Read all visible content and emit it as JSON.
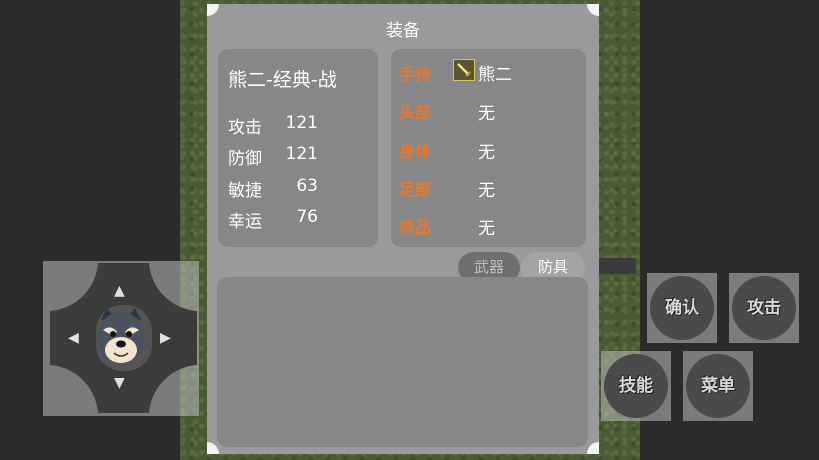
{
  "window": {
    "title": "装备"
  },
  "character": {
    "name": "熊二-经典-战",
    "stats": [
      {
        "label": "攻击",
        "value": "121"
      },
      {
        "label": "防御",
        "value": "121"
      },
      {
        "label": "敏捷",
        "value": "63"
      },
      {
        "label": "幸运",
        "value": "76"
      }
    ]
  },
  "equipment": {
    "slots": [
      {
        "label": "手持",
        "value": "熊二",
        "icon": "sword-icon"
      },
      {
        "label": "头部",
        "value": "无"
      },
      {
        "label": "身体",
        "value": "无"
      },
      {
        "label": "足部",
        "value": "无"
      },
      {
        "label": "饰品",
        "value": "无"
      }
    ]
  },
  "tabs": {
    "weapon": "武器",
    "armor": "防具",
    "active": "armor"
  },
  "controls": {
    "confirm": "确认",
    "attack": "攻击",
    "skill": "技能",
    "menu": "菜单"
  },
  "colors": {
    "slot_label": "#e8772e",
    "panel_bg": "#9a9a9c",
    "box_bg": "#878789"
  },
  "icons": {
    "dpad_center": "bear-face-icon",
    "arrows": [
      "arrow-up-icon",
      "arrow-down-icon",
      "arrow-left-icon",
      "arrow-right-icon"
    ]
  }
}
